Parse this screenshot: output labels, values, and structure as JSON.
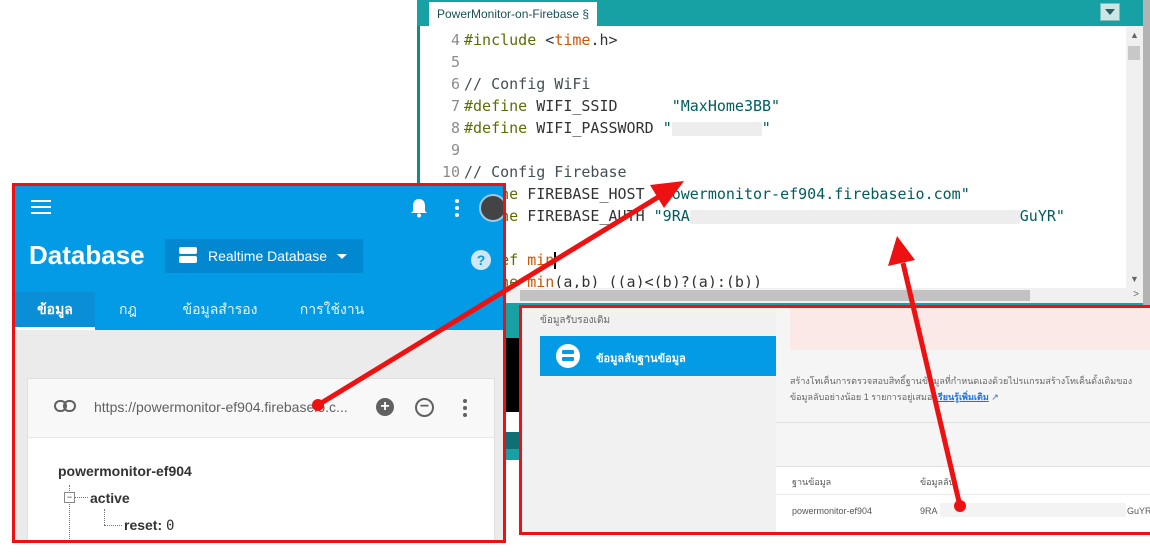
{
  "ide": {
    "tab_label": "PowerMonitor-on-Firebase §",
    "lines": [
      {
        "n": "4",
        "segs": [
          [
            "dir",
            "#include "
          ],
          [
            "plain",
            "<"
          ],
          [
            "fn",
            "time"
          ],
          [
            "plain",
            ".h>"
          ]
        ]
      },
      {
        "n": "5",
        "segs": []
      },
      {
        "n": "6",
        "segs": [
          [
            "cmt",
            "// Config WiFi"
          ]
        ]
      },
      {
        "n": "7",
        "segs": [
          [
            "dir",
            "#define "
          ],
          [
            "plain",
            "WIFI_SSID      "
          ],
          [
            "str",
            "\"MaxHome3BB\""
          ]
        ]
      },
      {
        "n": "8",
        "segs": [
          [
            "dir",
            "#define "
          ],
          [
            "plain",
            "WIFI_PASSWORD "
          ],
          [
            "str",
            "\""
          ],
          [
            "blur",
            "90"
          ],
          [
            "str",
            "\""
          ]
        ]
      },
      {
        "n": "9",
        "segs": []
      },
      {
        "n": "10",
        "segs": [
          [
            "cmt",
            "// Config Firebase"
          ]
        ]
      },
      {
        "n": "",
        "segs": [
          [
            "dir",
            "   ine "
          ],
          [
            "plain",
            "FIREBASE_HOST "
          ],
          [
            "str",
            "\"powermonitor-ef904.firebaseio.com\""
          ]
        ]
      },
      {
        "n": "",
        "segs": [
          [
            "dir",
            "   ine "
          ],
          [
            "plain",
            "FIREBASE_AUTH "
          ],
          [
            "str",
            "\"9RA"
          ],
          [
            "blur",
            "330"
          ],
          [
            "str",
            "GuYR\""
          ]
        ]
      },
      {
        "n": "",
        "segs": []
      },
      {
        "n": "",
        "segs": [
          [
            "dir",
            "   def "
          ],
          [
            "fn",
            "min"
          ],
          [
            "caret",
            ""
          ]
        ]
      },
      {
        "n": "",
        "segs": [
          [
            "dir",
            "   ine "
          ],
          [
            "fn",
            "min"
          ],
          [
            "plain",
            "(a,b) ((a)<(b)?(a):(b))"
          ]
        ]
      }
    ]
  },
  "firebase": {
    "title": "Database",
    "db_selector": "Realtime Database",
    "tabs": [
      "ข้อมูล",
      "กฎ",
      "ข้อมูลสำรอง",
      "การใช้งาน"
    ],
    "url": "https://powermonitor-ef904.firebaseio.c...",
    "tree": {
      "root": "powermonitor-ef904",
      "child": "active",
      "leaf_key": "reset:",
      "leaf_value": "0"
    }
  },
  "settings": {
    "legacy_header": "ข้อมูลรับรองเดิม",
    "active_item": "ข้อมูลลับฐานข้อมูล",
    "desc_line1": "สร้างโทเค็นการตรวจสอบสิทธิ์ฐานข้อมูลที่กำหนดเองด้วยไปรแกรมสร้างโทเค็นดั้งเดิมของ",
    "desc_line2": "ข้อมูลลับอย่างน้อย 1 รายการอยู่เสมอ",
    "learn_more": "เรียนรู้เพิ่มเติม",
    "col_database": "ฐานข้อมูล",
    "col_secret": "ข้อมูลลับ",
    "row_database": "powermonitor-ef904",
    "row_secret_prefix": "9RA",
    "row_secret_suffix": "GuYR"
  },
  "colors": {
    "annotation": "#ee1111",
    "firebase_blue": "#039be5",
    "arduino_teal": "#17a1a5"
  },
  "icons": [
    "menu-icon",
    "bell-icon",
    "more-vert-icon",
    "avatar",
    "database-icon",
    "help-icon",
    "link-icon",
    "add-icon",
    "remove-icon",
    "external-link-icon"
  ]
}
